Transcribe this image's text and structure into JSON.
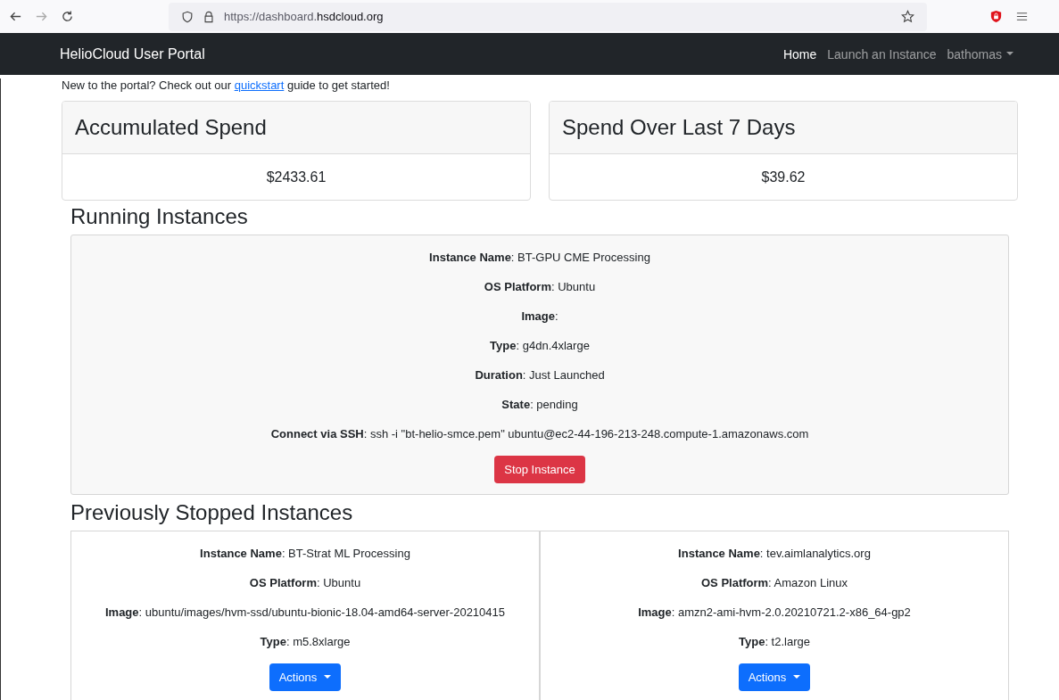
{
  "browser": {
    "url_prefix": "https://dashboard.",
    "url_domain": "hsdcloud.org"
  },
  "navbar": {
    "brand": "HelioCloud User Portal",
    "links": [
      {
        "label": "Home",
        "selected": true,
        "kind": "link"
      },
      {
        "label": "Launch an Instance",
        "selected": false,
        "kind": "link"
      },
      {
        "label": "bathomas",
        "selected": false,
        "kind": "dropdown"
      }
    ]
  },
  "intro": {
    "before": "New to the portal? Check out our",
    "link": "quickstart",
    "after": "guide to get started!"
  },
  "spend_cards": [
    {
      "title": "Accumulated Spend",
      "value": "$2433.61"
    },
    {
      "title": "Spend Over Last 7 Days",
      "value": "$39.62"
    }
  ],
  "running": {
    "heading": "Running Instances",
    "instances": [
      {
        "lines": [
          "**Instance Name**: BT-GPU CME Processing",
          "**OS Platform**: Ubuntu",
          "**Image**:",
          "**Type**: g4dn.4xlarge",
          "**Duration**: Just Launched",
          "**State**: pending",
          "**Connect via SSH**: ssh -i \"bt-helio-smce.pem\" ubuntu@ec2-44-196-213-248.compute-1.amazonaws.com"
        ],
        "button": {
          "label": "Stop Instance",
          "kind": "danger"
        }
      }
    ]
  },
  "stopped": {
    "heading": "Previously Stopped Instances",
    "instances": [
      {
        "lines": [
          "**Instance Name**: BT-Strat ML Processing",
          "**OS Platform**: Ubuntu",
          "**Image**: ubuntu/images/hvm-ssd/ubuntu-bionic-18.04-amd64-server-20210415",
          "**Type**: m5.8xlarge"
        ],
        "button": {
          "label": "Actions",
          "kind": "dropdown"
        }
      },
      {
        "lines": [
          "**Instance Name**: tev.aimlanalytics.org",
          "**OS Platform**: Amazon Linux",
          "**Image**: amzn2-ami-hvm-2.0.20210721.2-x86_64-gp2",
          "**Type**: t2.large"
        ],
        "button": {
          "label": "Actions",
          "kind": "dropdown"
        }
      }
    ]
  }
}
